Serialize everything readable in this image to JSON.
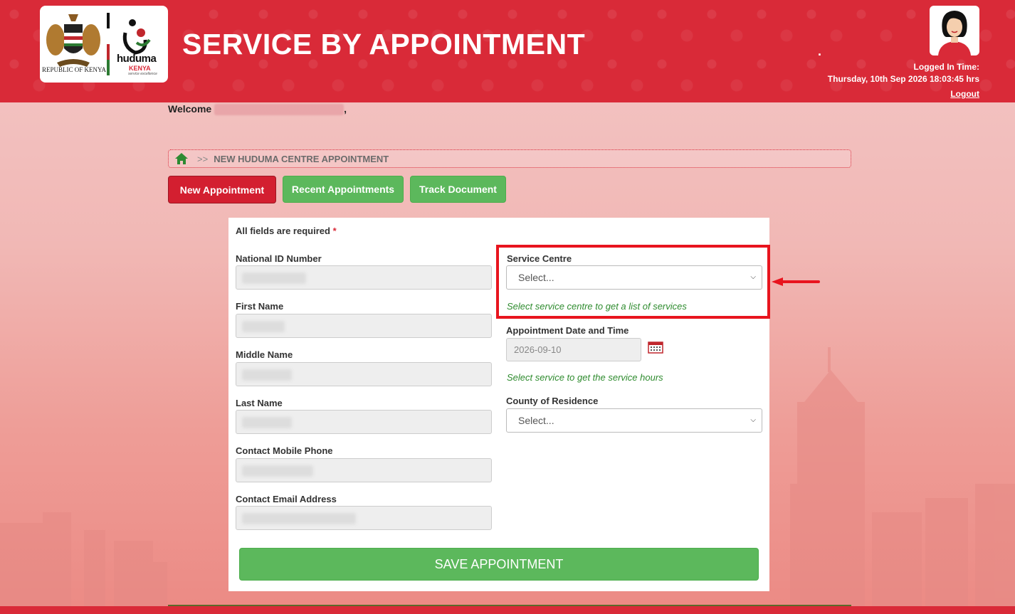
{
  "header": {
    "title": "SERVICE BY APPOINTMENT",
    "logo_left_text": "REPUBLIC OF KENYA",
    "logo_right_word": "huduma",
    "logo_right_sub": "KENYA",
    "logo_right_slogan": "service excellence",
    "dot": ".",
    "login_label": "Logged In Time:",
    "login_time": "Thursday, 10th Sep 2026 18:03:45 hrs",
    "logout": "Logout"
  },
  "welcome": {
    "prefix": "Welcome",
    "suffix": ","
  },
  "breadcrumb": {
    "separator": ">>",
    "current": "NEW HUDUMA CENTRE APPOINTMENT"
  },
  "tabs": [
    {
      "label": "New Appointment"
    },
    {
      "label": "Recent Appointments"
    },
    {
      "label": "Track Document"
    }
  ],
  "form": {
    "required_note": "All fields are required",
    "required_star": "*",
    "left_fields": [
      {
        "label": "National ID Number"
      },
      {
        "label": "First Name"
      },
      {
        "label": "Middle Name"
      },
      {
        "label": "Last Name"
      },
      {
        "label": "Contact Mobile Phone"
      },
      {
        "label": "Contact Email Address"
      }
    ],
    "service_centre": {
      "label": "Service Centre",
      "selected": "Select...",
      "hint": "Select service centre to get a list of services"
    },
    "appointment": {
      "label": "Appointment Date and Time",
      "date_value": "2026-09-10",
      "hint": "Select service to get the service hours"
    },
    "county": {
      "label": "County of Residence",
      "selected": "Select..."
    },
    "save_label": "SAVE APPOINTMENT"
  },
  "colors": {
    "brand_red": "#d92a38",
    "green": "#5cb85c",
    "highlight": "#e8141e"
  }
}
